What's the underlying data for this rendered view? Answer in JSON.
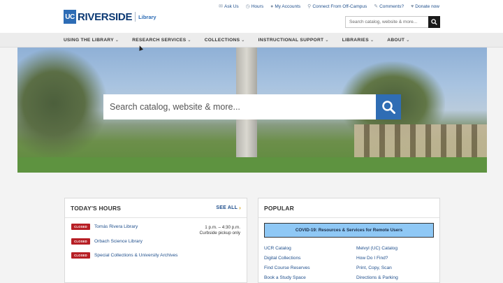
{
  "logo": {
    "uc": "UC",
    "name": "RIVERSIDE",
    "sub": "Library"
  },
  "utility": [
    {
      "label": "Ask Us",
      "icon": "chat-icon"
    },
    {
      "label": "Hours",
      "icon": "clock-icon"
    },
    {
      "label": "My Accounts",
      "icon": "user-icon"
    },
    {
      "label": "Connect From Off-Campus",
      "icon": "plug-icon"
    },
    {
      "label": "Comments?",
      "icon": "comment-icon"
    },
    {
      "label": "Donate now",
      "icon": "gift-icon"
    }
  ],
  "top_search": {
    "placeholder": "Search catalog, website & more..."
  },
  "nav": [
    "USING THE LIBRARY",
    "RESEARCH SERVICES",
    "COLLECTIONS",
    "INSTRUCTIONAL SUPPORT",
    "LIBRARIES",
    "ABOUT"
  ],
  "hero_search": {
    "placeholder": "Search catalog, website & more..."
  },
  "hours": {
    "title": "TODAY'S HOURS",
    "see_all": "SEE ALL",
    "rows": [
      {
        "status": "CLOSED",
        "library": "Tomás Rivera Library"
      },
      {
        "status": "CLOSED",
        "library": "Orbach Science Library"
      },
      {
        "status": "CLOSED",
        "library": "Special Collections & University Archives"
      }
    ],
    "time_line1": "1 p.m. – 4:30 p.m.",
    "time_line2": "Curbside pickup only"
  },
  "popular": {
    "title": "POPULAR",
    "banner": "COVID-19: Resources & Services for Remote Users",
    "left": [
      "UCR Catalog",
      "Digital Collections",
      "Find Course Reserves",
      "Book a Study Space"
    ],
    "right": [
      "Melvyl (UC) Catalog",
      "How Do I Find?",
      "Print, Copy, Scan",
      "Directions & Parking"
    ]
  },
  "colors": {
    "brand_blue": "#2d6cb5",
    "navy": "#0d3a74",
    "closed_red": "#b71f25",
    "link": "#1f4f8c",
    "covid_bg": "#8fc8f5"
  }
}
